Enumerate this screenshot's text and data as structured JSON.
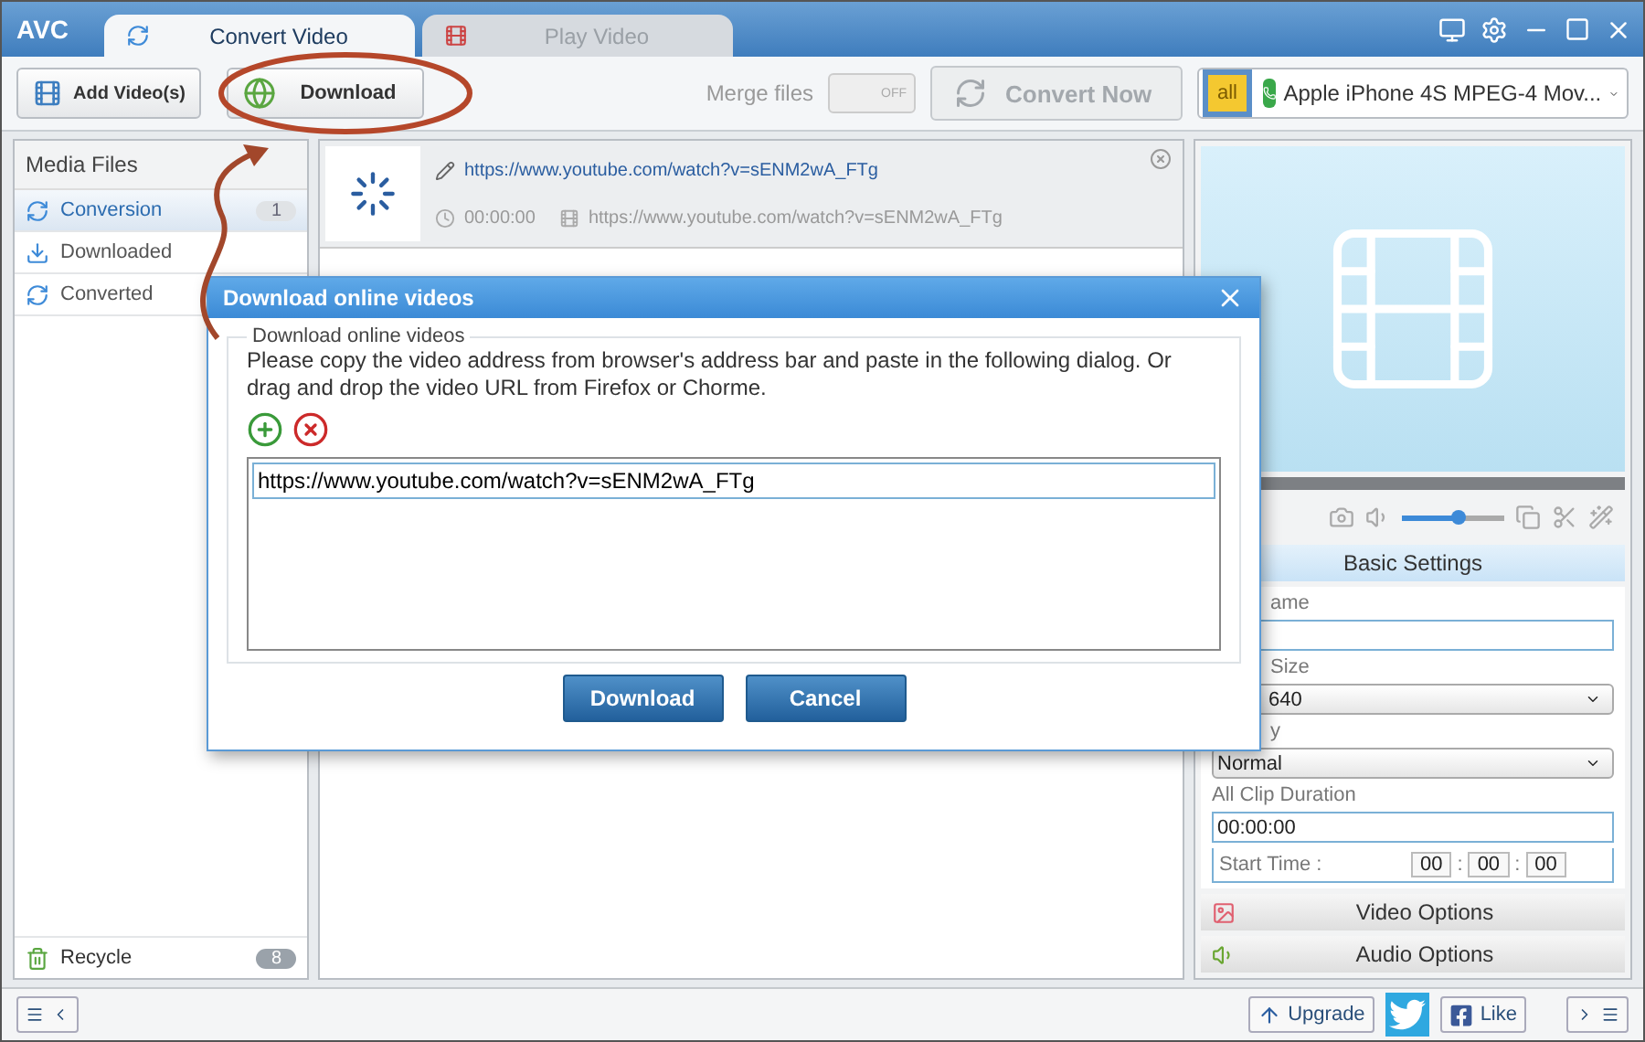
{
  "window": {
    "logo": "AVC",
    "tabs": [
      {
        "label": "Convert Video",
        "selected": true
      },
      {
        "label": "Play Video",
        "selected": false
      }
    ]
  },
  "toolbar": {
    "add_button": "Add Video(s)",
    "download_button": "Download",
    "merge_label": "Merge files",
    "merge_switch": {
      "label": "OFF",
      "on": false
    },
    "convert_button": {
      "label": "Convert Now",
      "disabled": true
    },
    "profile_badge": "all",
    "profile": "Apple iPhone 4S MPEG-4 Mov..."
  },
  "sidebar": {
    "title": "Media Files",
    "items": [
      {
        "label": "Conversion",
        "count": "1",
        "selected": true
      },
      {
        "label": "Downloaded",
        "selected": false
      },
      {
        "label": "Converted",
        "selected": false
      }
    ],
    "recycle": {
      "label": "Recycle",
      "count": "8"
    }
  },
  "task": {
    "title": "https://www.youtube.com/watch?v=sENM2wA_FTg",
    "duration": "00:00:00",
    "source": "https://www.youtube.com/watch?v=sENM2wA_FTg"
  },
  "player": {
    "seek": {
      "level": 0
    },
    "volume": {
      "level": 0.55
    }
  },
  "settings": {
    "header": "Basic Settings",
    "fields": [
      {
        "label": "ame",
        "kind": "text"
      },
      {
        "label": "Size",
        "kind": "select",
        "value": "640"
      },
      {
        "label": "y",
        "kind": "select",
        "value": "Normal"
      },
      {
        "label": "All Clip Duration",
        "kind": "text",
        "value": "00:00:00"
      }
    ],
    "start_time": {
      "label": "Start Time :",
      "parts": [
        "00",
        "00",
        "00"
      ],
      "separators": [
        ":",
        ":"
      ]
    },
    "sections": [
      "Video Options",
      "Audio Options"
    ]
  },
  "status_bar": {
    "upgrade": "Upgrade",
    "like": "Like"
  },
  "dialog": {
    "title": "Download online videos",
    "group_label": "Download online videos",
    "instructions": "Please copy the video address from browser's address bar and paste in the following dialog. Or drag and drop the video URL from Firefox or Chorme.",
    "urls": [
      "https://www.youtube.com/watch?v=sENM2wA_FTg"
    ],
    "buttons": [
      "Download",
      "Cancel"
    ]
  }
}
